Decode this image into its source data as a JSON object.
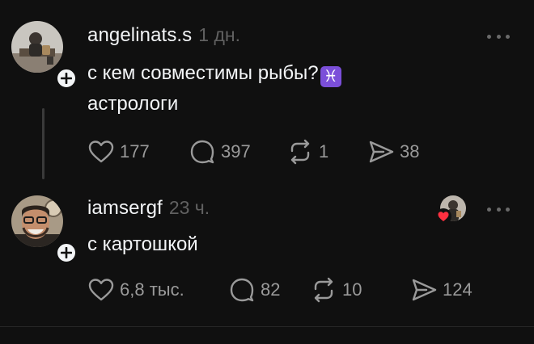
{
  "posts": [
    {
      "username": "angelinats.s",
      "timestamp": "1 дн.",
      "text_line1": "с кем совместимы рыбы?",
      "emoji": "♓",
      "text_line2": "астрологи",
      "likes": "177",
      "comments": "397",
      "reposts": "1",
      "shares": "38"
    },
    {
      "username": "iamsergf",
      "timestamp": "23 ч.",
      "text_line1": "с картошкой",
      "likes": "6,8 тыс.",
      "comments": "82",
      "reposts": "10",
      "shares": "124"
    }
  ],
  "icons": {
    "like": "heart-icon",
    "comment": "comment-bubble-icon",
    "repost": "repost-icon",
    "share": "send-icon",
    "more": "more-dots-icon",
    "follow": "plus-icon",
    "liked_by_author": "heart-badge-icon"
  },
  "colors": {
    "background": "#101010",
    "text": "#f3f5f7",
    "muted": "#616161",
    "action": "#9a9a9a",
    "heart_badge": "#ff3040",
    "emoji_bg": "#7b4fd9"
  }
}
